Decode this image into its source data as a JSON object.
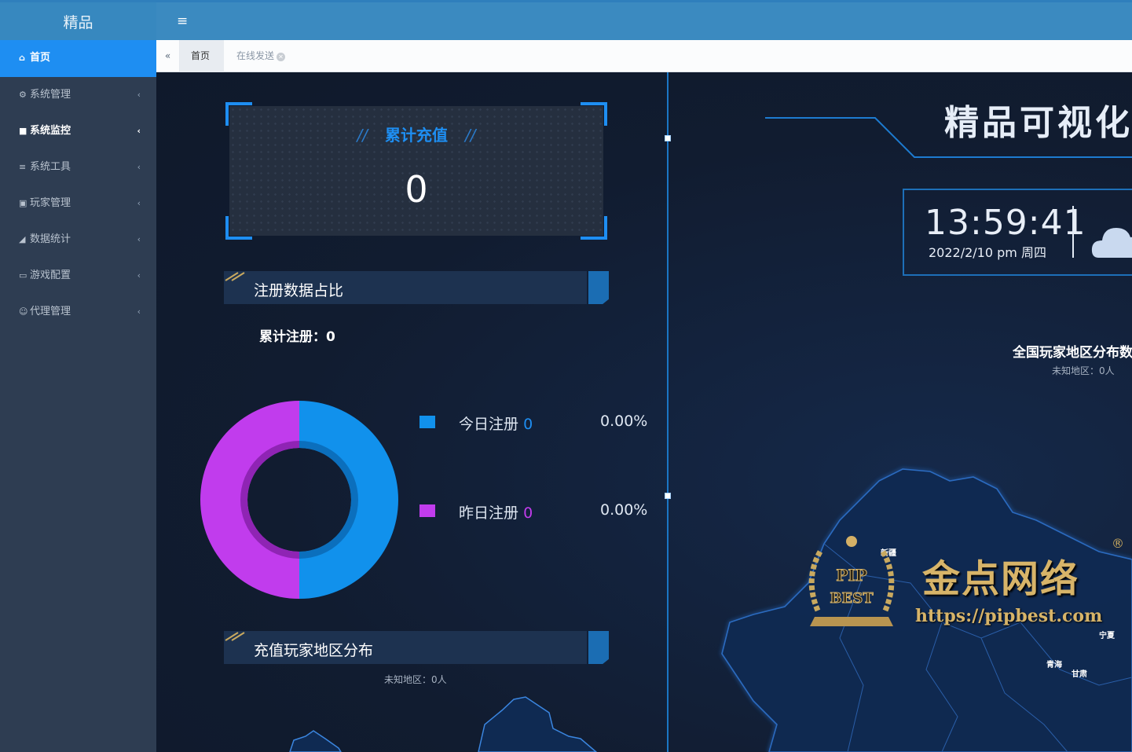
{
  "brand": "精品",
  "sidebar": {
    "items": [
      {
        "label": "首页",
        "icon": "home-icon",
        "active": true
      },
      {
        "label": "系统管理",
        "icon": "gear-icon"
      },
      {
        "label": "系统监控",
        "icon": "video-icon",
        "hover": true
      },
      {
        "label": "系统工具",
        "icon": "bars-icon"
      },
      {
        "label": "玩家管理",
        "icon": "user-card-icon"
      },
      {
        "label": "数据统计",
        "icon": "area-chart-icon"
      },
      {
        "label": "游戏配置",
        "icon": "monitor-icon"
      },
      {
        "label": "代理管理",
        "icon": "users-icon"
      }
    ]
  },
  "topbar": {
    "menu_icon": "≡"
  },
  "tabs": {
    "back_icon": "«",
    "items": [
      {
        "label": "首页"
      },
      {
        "label": "在线发送"
      }
    ]
  },
  "dashboard": {
    "recharge": {
      "title": "累计充值",
      "deco": "//",
      "value": "0"
    },
    "register_section": {
      "title": "注册数据占比",
      "total_label": "累计注册：0"
    },
    "register_chart": {
      "type": "pie",
      "series": [
        {
          "name": "今日注册",
          "count": "0",
          "percent": "0.00%",
          "share": 50,
          "color": "#1191ec"
        },
        {
          "name": "昨日注册",
          "count": "0",
          "percent": "0.00%",
          "share": 50,
          "color": "#c13ced"
        }
      ]
    },
    "recharge_region_section": {
      "title": "充值玩家地区分布",
      "unknown": "未知地区：0人"
    },
    "big_title": "精品可视化",
    "clock": {
      "time": "13:59:41",
      "date": "2022/2/10  pm  周四"
    },
    "map_section": {
      "title": "全国玩家地区分布数",
      "unknown": "未知地区：0人"
    },
    "map_labels": [
      "新疆",
      "宁夏",
      "青海",
      "甘肃"
    ],
    "watermark": {
      "cn": "金点网络",
      "url": "https://pipbest.com",
      "seal_top": "PIP",
      "seal_bottom": "BEST",
      "reg": "®"
    },
    "colors": {
      "accent": "#1e8ef2",
      "today": "#1191ec",
      "yesterday": "#c13ced",
      "header": "#3b8ac0"
    }
  }
}
